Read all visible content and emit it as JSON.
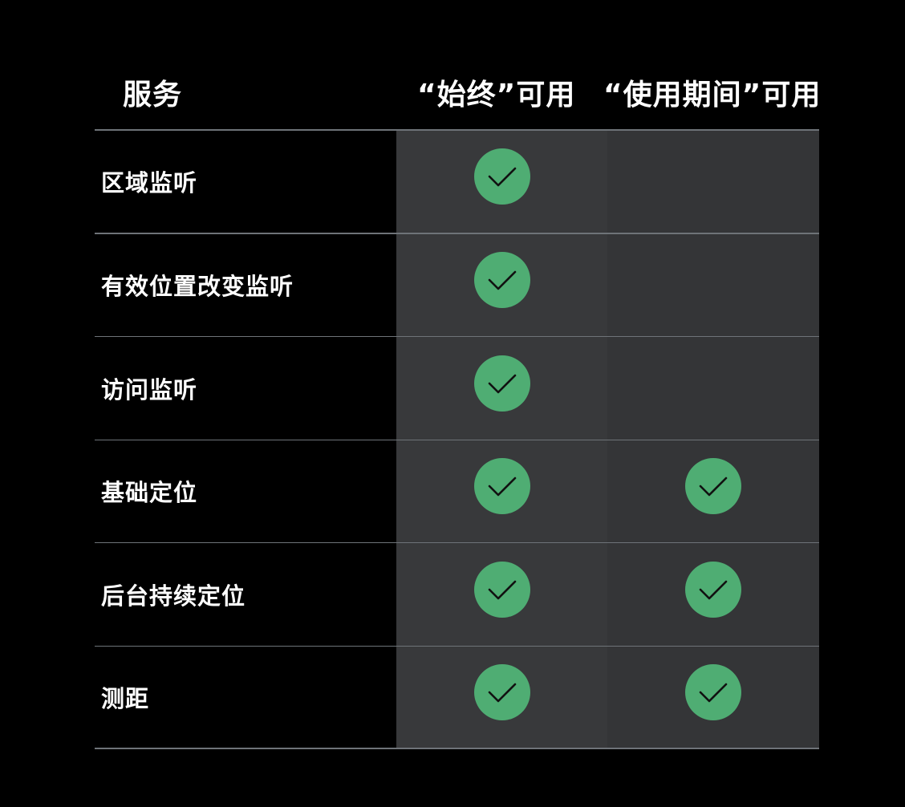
{
  "colors": {
    "background": "#000000",
    "always_column": "#38393b",
    "inuse_column": "#343537",
    "check_fill": "#4fad73",
    "check_stroke": "#111111",
    "divider": "#6e7378"
  },
  "header": {
    "service": "服务",
    "always": "“始终”可用",
    "in_use": "“使用期间”可用"
  },
  "rows": [
    {
      "label": "区域监听",
      "always": true,
      "in_use": false
    },
    {
      "label": "有效位置改变监听",
      "always": true,
      "in_use": false
    },
    {
      "label": "访问监听",
      "always": true,
      "in_use": false
    },
    {
      "label": "基础定位",
      "always": true,
      "in_use": true
    },
    {
      "label": "后台持续定位",
      "always": true,
      "in_use": true
    },
    {
      "label": "测距",
      "always": true,
      "in_use": true
    }
  ],
  "icons": {
    "check": "checkmark-icon"
  }
}
